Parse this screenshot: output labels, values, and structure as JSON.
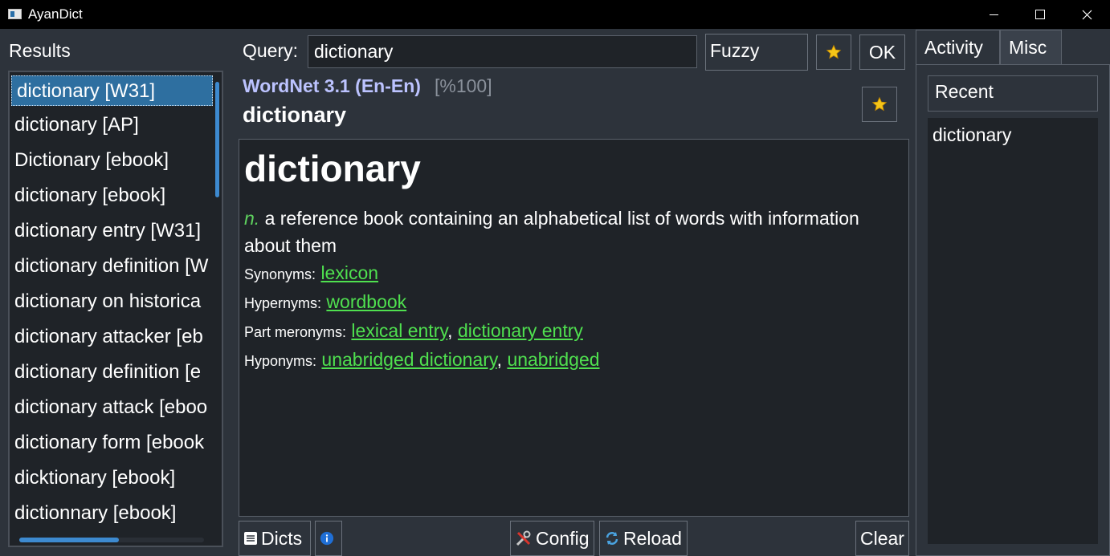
{
  "window": {
    "title": "AyanDict"
  },
  "results": {
    "heading": "Results",
    "items": [
      "dictionary [W31]",
      "dictionary [AP]",
      "Dictionary [ebook]",
      "dictionary [ebook]",
      "dictionary entry [W31]",
      "dictionary definition [W",
      "dictionary on historica",
      "dictionary attacker [eb",
      "dictionary definition [e",
      "dictionary attack [eboo",
      "dictionary form [ebook",
      "dicktionary [ebook]",
      "dictionnary [ebook]"
    ]
  },
  "query": {
    "label": "Query:",
    "value": "dictionary",
    "mode": "Fuzzy",
    "ok_label": "OK"
  },
  "entry": {
    "dict_name": "WordNet 3.1 (En-En)",
    "score": "[%100]",
    "headword": "dictionary",
    "title": "dictionary",
    "pos": "n.",
    "definition": "a reference book containing an alphabetical list of words with information about them",
    "relations": {
      "synonyms_label": "Synonyms:",
      "synonyms": [
        "lexicon"
      ],
      "hypernyms_label": "Hypernyms:",
      "hypernyms": [
        "wordbook"
      ],
      "meronyms_label": "Part meronyms:",
      "meronyms": [
        "lexical entry",
        "dictionary entry"
      ],
      "hyponyms_label": "Hyponyms:",
      "hyponyms": [
        "unabridged dictionary",
        "unabridged"
      ]
    }
  },
  "bottom": {
    "dicts_label": "Dicts",
    "config_label": "Config",
    "reload_label": "Reload",
    "clear_label": "Clear"
  },
  "side": {
    "tabs": [
      "Activity",
      "Misc"
    ],
    "selector": "Recent",
    "recent_items": [
      "dictionary"
    ]
  },
  "colors": {
    "background": "#2d333b",
    "panel": "#1f2328",
    "selection": "#2e6fa0",
    "link": "#4fe04f",
    "dict_name": "#bcc3ff"
  }
}
